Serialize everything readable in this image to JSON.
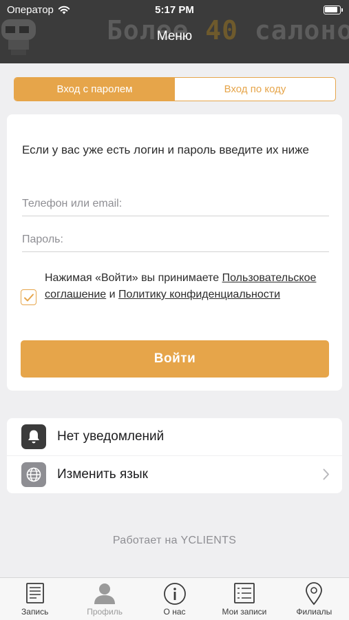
{
  "status_bar": {
    "carrier": "Оператор",
    "time": "5:17 PM"
  },
  "banner": {
    "text_before": "Более ",
    "text_highlight": "40",
    "text_after": " салонов в Р"
  },
  "nav": {
    "title": "Меню"
  },
  "login_tabs": [
    {
      "label": "Вход с паролем",
      "active": true
    },
    {
      "label": "Вход по коду",
      "active": false
    }
  ],
  "login_form": {
    "intro": "Если у вас уже есть логин и пароль введите их ниже",
    "phone_placeholder": "Телефон или email:",
    "phone_value": "",
    "password_placeholder": "Пароль:",
    "password_value": "",
    "agreement_checked": true,
    "agreement_prefix": "Нажимая «Войти» вы принимаете ",
    "agreement_link1": "Пользовательское соглашение",
    "agreement_and": " и ",
    "agreement_link2": "Политику конфиденциальности",
    "submit_label": "Войти"
  },
  "menu": [
    {
      "label": "Нет уведомлений",
      "icon": "bell-icon"
    },
    {
      "label": "Изменить язык",
      "icon": "globe-icon"
    }
  ],
  "footer": {
    "powered_by": "Работает на YCLIENTS"
  },
  "tabbar": [
    {
      "label": "Запись",
      "icon": "document-icon",
      "active": true
    },
    {
      "label": "Профиль",
      "icon": "person-icon",
      "active": false
    },
    {
      "label": "О нас",
      "icon": "info-icon",
      "active": true
    },
    {
      "label": "Мои записи",
      "icon": "list-icon",
      "active": true
    },
    {
      "label": "Филиалы",
      "icon": "location-pin-icon",
      "active": true
    }
  ],
  "colors": {
    "accent": "#e6a54a",
    "header_bg": "#3b3b3b",
    "background": "#efeff1"
  }
}
